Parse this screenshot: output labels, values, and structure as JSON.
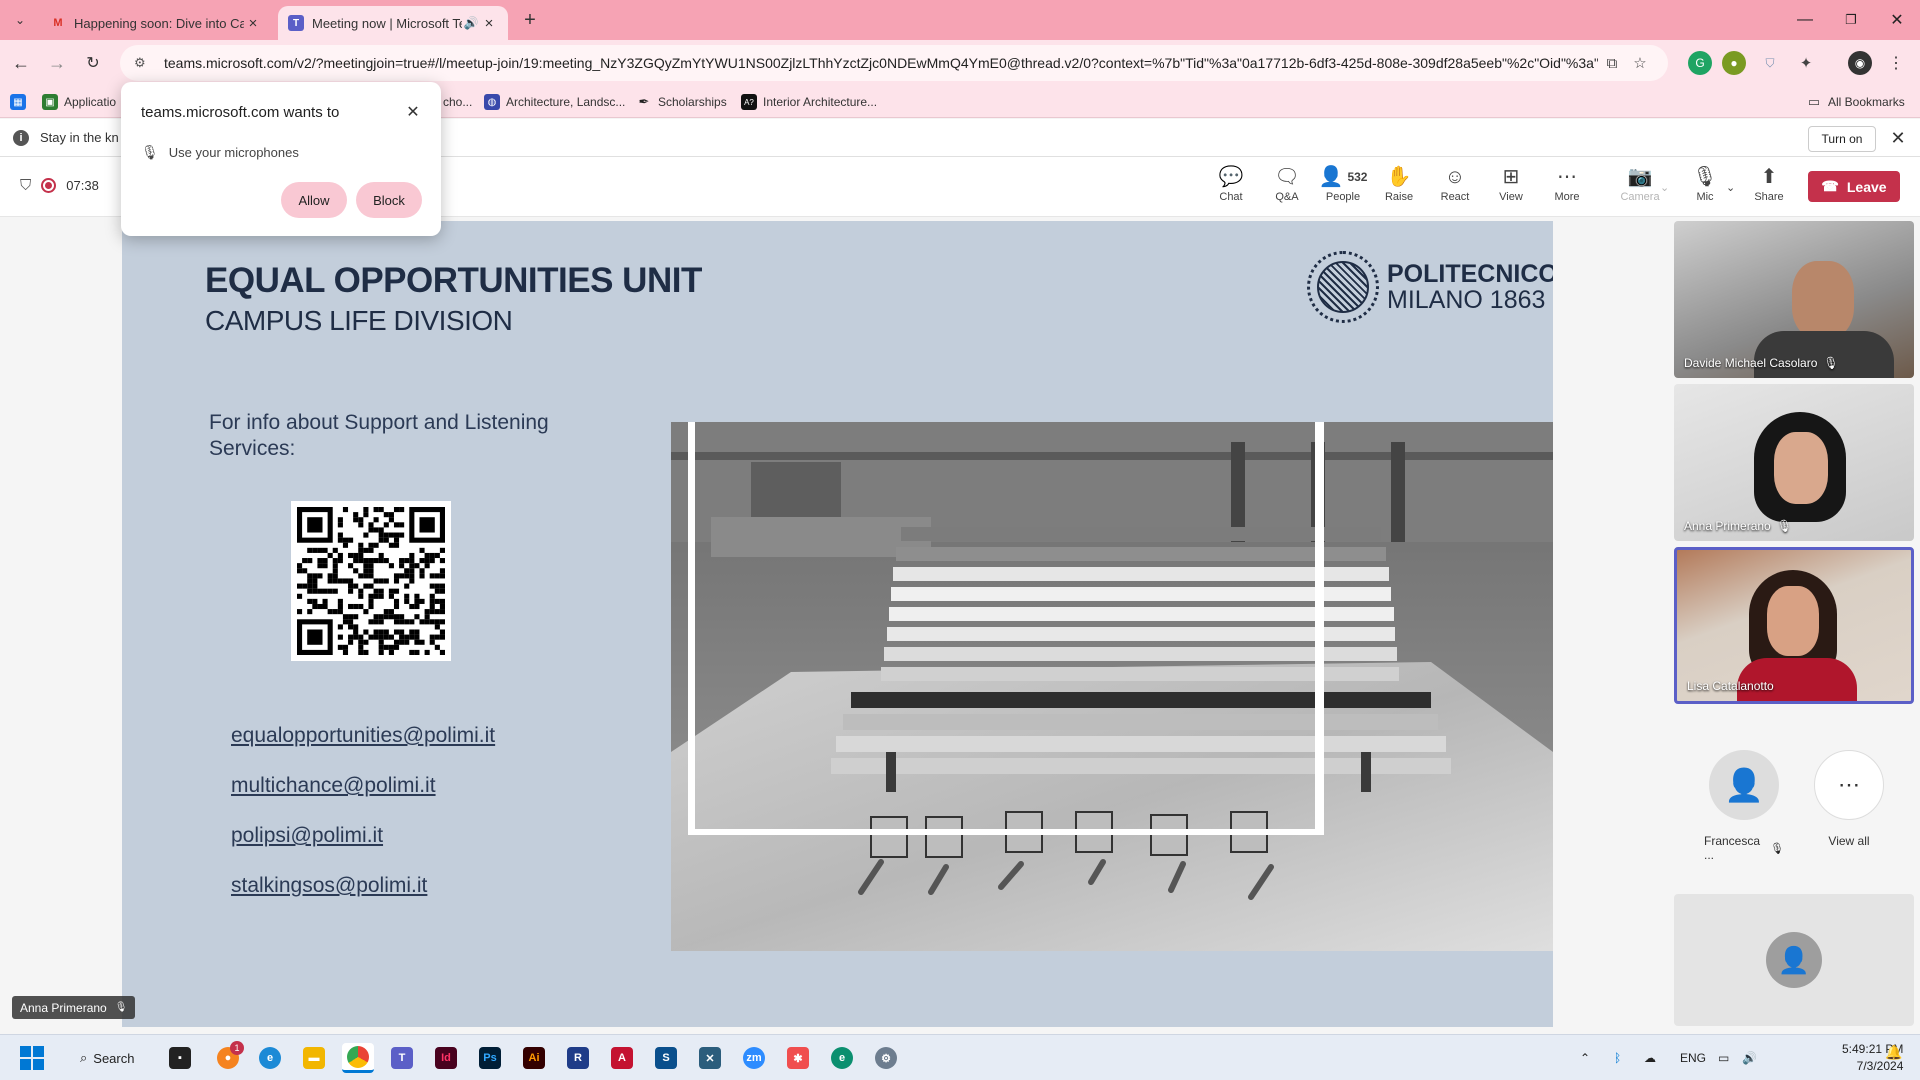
{
  "browser": {
    "tabs": [
      {
        "title": "Happening soon: Dive into Cam",
        "favicon": "gmail-icon"
      },
      {
        "title": "Meeting now | Microsoft Te",
        "favicon": "teams-icon",
        "audio": true
      }
    ],
    "url": "teams.microsoft.com/v2/?meetingjoin=true#/l/meetup-join/19:meeting_NzY3ZGQyZmYtYWU1NS00ZjlzLThhYzctZjc0NDEwMmQ4YmE0@thread.v2/0?context=%7b\"Tid\"%3a\"0a17712b-6df3-425d-808e-309df28a5eeb\"%2c\"Oid\"%3a\"c...",
    "bookmarks": [
      {
        "label": "Applicatio",
        "icon": "applications-icon"
      },
      {
        "label": "cho...",
        "icon": "bookmark-icon"
      },
      {
        "label": "Architecture, Landsc...",
        "icon": "globe-icon"
      },
      {
        "label": "Scholarships",
        "icon": "feather-icon"
      },
      {
        "label": "Interior Architecture...",
        "icon": "ai-icon"
      }
    ],
    "all_bookmarks": "All Bookmarks"
  },
  "infobar": {
    "message": "Stay in the kn",
    "turn_on": "Turn on"
  },
  "permission": {
    "title": "teams.microsoft.com wants to",
    "request": "Use your microphones",
    "allow": "Allow",
    "block": "Block"
  },
  "meeting": {
    "timer": "07:38",
    "controls": [
      {
        "label": "Chat",
        "icon": "chat-icon"
      },
      {
        "label": "Q&A",
        "icon": "qa-icon"
      },
      {
        "label": "People",
        "icon": "people-icon",
        "count": "532"
      },
      {
        "label": "Raise",
        "icon": "raise-hand-icon"
      },
      {
        "label": "React",
        "icon": "react-icon"
      },
      {
        "label": "View",
        "icon": "view-icon"
      },
      {
        "label": "More",
        "icon": "more-icon"
      },
      {
        "label": "Camera",
        "icon": "camera-off-icon",
        "disabled": true
      },
      {
        "label": "Mic",
        "icon": "mic-off-icon"
      },
      {
        "label": "Share",
        "icon": "share-icon"
      }
    ],
    "leave": "Leave",
    "leave_color": "#c4314b"
  },
  "slide": {
    "title": "EQUAL OPPORTUNITIES UNIT",
    "subtitle": "CAMPUS LIFE DIVISION",
    "logo_line1": "POLITECNICO",
    "logo_line2": "MILANO 1863",
    "info": "For info about Support and Listening Services:",
    "links": [
      "equalopportunities@polimi.it",
      "multichance@polimi.it",
      "polipsi@polimi.it",
      "stalkingsos@polimi.it"
    ]
  },
  "participants": [
    {
      "name": "Davide Michael Casolaro",
      "muted": true
    },
    {
      "name": "Anna Primerano",
      "muted": true
    },
    {
      "name": "Lisa Catalanotto",
      "muted": false,
      "active": true
    }
  ],
  "others": {
    "person": "Francesca ...",
    "view_all": "View all"
  },
  "presenter_badge": "Anna Primerano",
  "taskbar": {
    "search": "Search",
    "language": "ENG",
    "time": "5:49:21 PM",
    "date": "7/3/2024",
    "badge_count": "1"
  }
}
